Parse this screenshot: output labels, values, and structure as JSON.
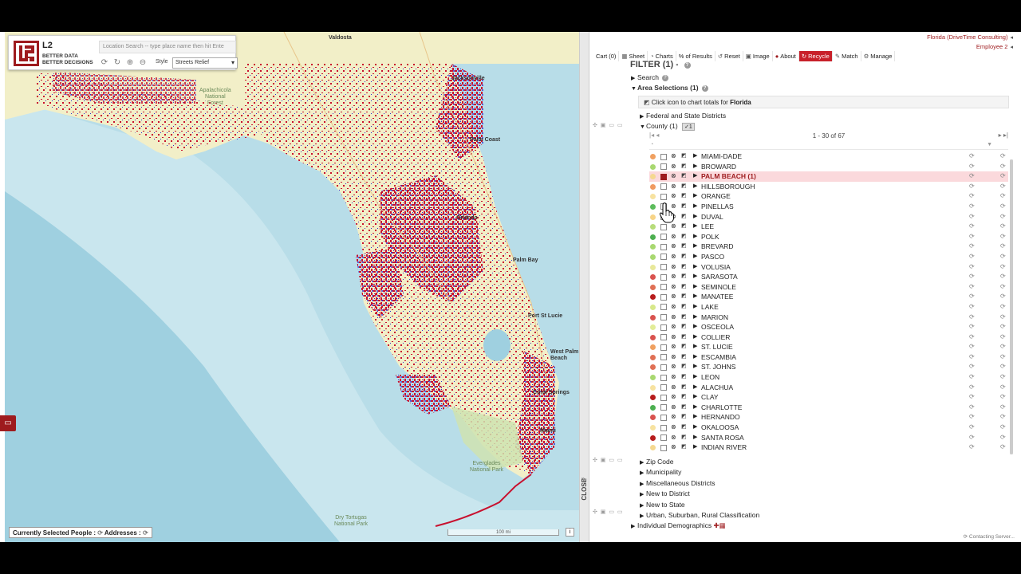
{
  "map": {
    "logo_text": "L2",
    "logo_tagline_1": "BETTER DATA",
    "logo_tagline_2": "BETTER DECISIONS",
    "search_placeholder": "Location Search -- type place name then hit Ente",
    "style_label": "Style",
    "style_value": "Streets Relief",
    "status": "Currently Selected People :",
    "status_addresses": "Addresses :",
    "scale_label": "100 mi",
    "labels": {
      "valdosta": "Valdosta",
      "jacksonville": "Jacksonville",
      "palm_coast": "Palm Coast",
      "apalachicola": "Apalachicola\nNational\nForest",
      "orlando": "Orlando",
      "palm_bay": "Palm Bay",
      "port_st_lucie": "Port St Lucie",
      "west_palm": "West Palm\nBeach",
      "coral_springs": "Coral Springs",
      "miami": "Miami",
      "everglades": "Everglades\nNational Park",
      "dry_tortugas": "Dry Tortugas\nNational Park"
    },
    "density_colors": {
      "red": "#c8102e",
      "blue": "#2b2bd1",
      "land": "#f2efc8",
      "water": "#b8dde8"
    }
  },
  "panel": {
    "account_line_1": "Florida (DriveTime Consulting)",
    "account_line_2": "Employee 2",
    "toolbar": {
      "cart": "Cart (0)",
      "sheet": "Sheet",
      "charts": "Charts",
      "results": "% of Results",
      "reset": "Reset",
      "image": "Image",
      "about": "About",
      "recycle": "Recycle",
      "match": "Match",
      "manage": "Manage"
    },
    "filter_title": "FILTER (1)",
    "search": "Search",
    "area_selections": "Area Selections (1)",
    "chart_tip_prefix": "Click icon to chart totals for",
    "chart_tip_state": "Florida",
    "federal_state": "Federal and State Districts",
    "county": "County (1)",
    "pager": "1 - 30 of 67",
    "counties": [
      {
        "name": "MIAMI-DADE",
        "color": "#f0a060"
      },
      {
        "name": "BROWARD",
        "color": "#a8d870"
      },
      {
        "name": "PALM BEACH (1)",
        "color": "#f5d890",
        "selected": true
      },
      {
        "name": "HILLSBOROUGH",
        "color": "#f09a60"
      },
      {
        "name": "ORANGE",
        "color": "#f7e2a0"
      },
      {
        "name": "PINELLAS",
        "color": "#5cbc5c"
      },
      {
        "name": "DUVAL",
        "color": "#f7d488"
      },
      {
        "name": "LEE",
        "color": "#b7dc7a"
      },
      {
        "name": "POLK",
        "color": "#4caf50"
      },
      {
        "name": "BREVARD",
        "color": "#a8d870"
      },
      {
        "name": "PASCO",
        "color": "#a8d870"
      },
      {
        "name": "VOLUSIA",
        "color": "#e8e89a"
      },
      {
        "name": "SARASOTA",
        "color": "#d9534f"
      },
      {
        "name": "SEMINOLE",
        "color": "#e07055"
      },
      {
        "name": "MANATEE",
        "color": "#b71c1c"
      },
      {
        "name": "LAKE",
        "color": "#d7e88a"
      },
      {
        "name": "MARION",
        "color": "#d9534f"
      },
      {
        "name": "OSCEOLA",
        "color": "#e2ec98"
      },
      {
        "name": "COLLIER",
        "color": "#d9534f"
      },
      {
        "name": "ST. LUCIE",
        "color": "#f0a060"
      },
      {
        "name": "ESCAMBIA",
        "color": "#e07055"
      },
      {
        "name": "ST. JOHNS",
        "color": "#e07055"
      },
      {
        "name": "LEON",
        "color": "#a8d870"
      },
      {
        "name": "ALACHUA",
        "color": "#f7e2a0"
      },
      {
        "name": "CLAY",
        "color": "#b71c1c"
      },
      {
        "name": "CHARLOTTE",
        "color": "#4caf50"
      },
      {
        "name": "HERNANDO",
        "color": "#d9534f"
      },
      {
        "name": "OKALOOSA",
        "color": "#f7e2a0"
      },
      {
        "name": "SANTA ROSA",
        "color": "#b71c1c"
      },
      {
        "name": "INDIAN RIVER",
        "color": "#f5d890"
      }
    ],
    "other_filters": [
      "Zip Code",
      "Municipality",
      "Miscellaneous Districts",
      "New to District",
      "New to State",
      "Urban, Suburban, Rural Classification"
    ],
    "individual_demographics": "Individual Demographics",
    "contacting": "Contacting Server...",
    "close_label": "CLOSE"
  }
}
